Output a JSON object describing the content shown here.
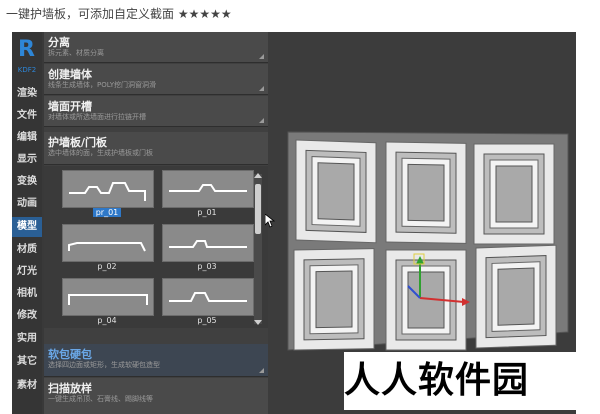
{
  "caption": "一键护墙板，可添加自定义截面 ★★★★★",
  "app": {
    "logo_letter": "R",
    "version": "KDF2"
  },
  "nav": [
    "渲染",
    "文件",
    "编辑",
    "显示",
    "变换",
    "动画",
    "模型",
    "材质",
    "灯光",
    "相机",
    "修改",
    "实用",
    "其它",
    "素材"
  ],
  "nav_active": "模型",
  "sections": [
    {
      "title": "分离",
      "desc": "拆元素、材质分离"
    },
    {
      "title": "创建墙体",
      "desc": "线条生成墙体，POLY挖门洞窗洞滑"
    },
    {
      "title": "墙面开槽",
      "desc": "对墙体或所选墙面进行拉链开槽"
    },
    {
      "title": "护墙板/门板",
      "desc": "选中墙体的面，生成护墙板或门板"
    },
    {
      "title": "软包硬包",
      "desc": "选择四边面或矩形，生成软硬包造型"
    },
    {
      "title": "扫描放样",
      "desc": "一键生成吊顶、石膏线、踢脚线等"
    }
  ],
  "profiles": [
    "pr_01",
    "p_01",
    "p_02",
    "p_03",
    "p_04",
    "p_05"
  ],
  "selected_profile": "pr_01",
  "watermark": "人人软件园",
  "colors": {
    "accent": "#2a5f95",
    "logo": "#2e86d6"
  }
}
